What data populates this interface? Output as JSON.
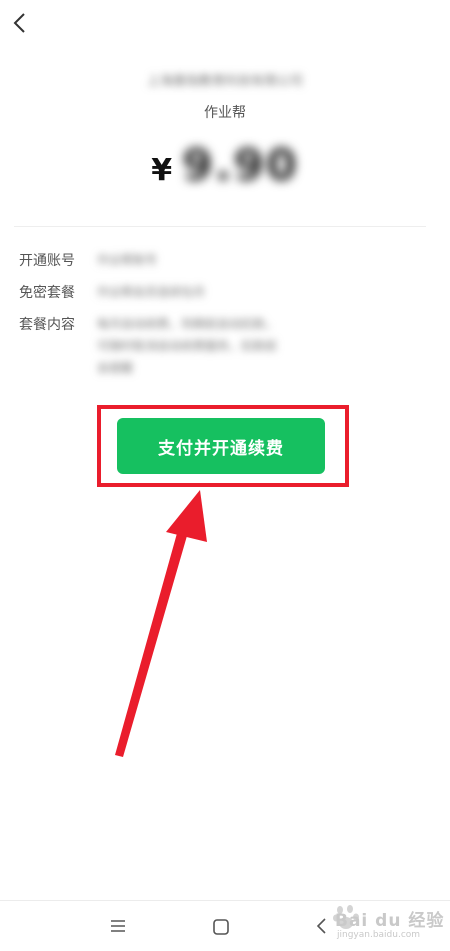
{
  "header": {
    "back_icon": "chevron-left-icon"
  },
  "merchant": {
    "name": "上海墨指教育科技有限公司",
    "app_name": "作业帮"
  },
  "price": {
    "currency": "¥",
    "amount": "9.90"
  },
  "details": {
    "rows": [
      {
        "label": "开通账号",
        "value": "作业帮账号"
      },
      {
        "label": "免密套餐",
        "value": "作业帮会员连续包月"
      },
      {
        "label": "套餐内容",
        "value_lines": [
          "每月自动续费，到期前自动扣款，",
          "可随时取消自动续费服务，扣款前",
          "会提醒"
        ]
      }
    ]
  },
  "action": {
    "pay_label": "支付并开通续费"
  },
  "annotation": {
    "box_color": "#ea1d2c",
    "arrow_color": "#ea1d2c"
  },
  "colors": {
    "primary_button": "#16c060"
  },
  "nav": {
    "menu_icon": "menu-icon",
    "home_icon": "home-square-icon",
    "back_icon": "back-triangle-icon"
  },
  "watermark": {
    "brand": "Bai du 经验",
    "url": "jingyan.baidu.com"
  }
}
